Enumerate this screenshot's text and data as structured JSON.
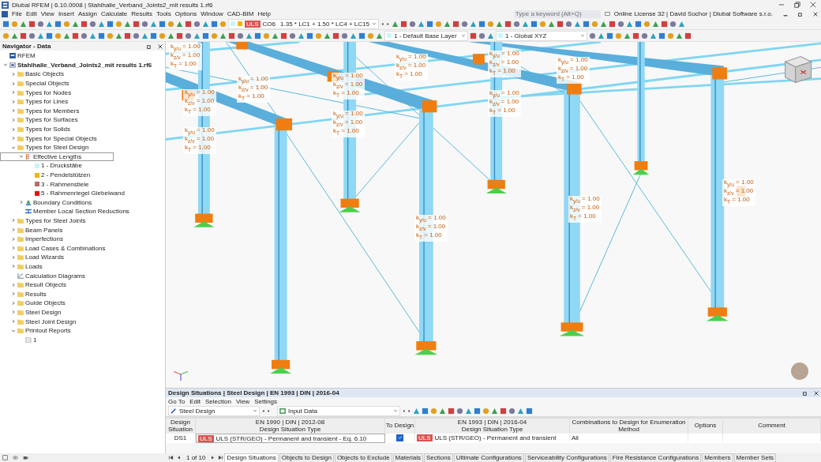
{
  "window": {
    "title": "Dlubal RFEM | 6.10.0008 | Stahlhalle_Verband_Joints2_mit results 1.rf6"
  },
  "menu": [
    "File",
    "Edit",
    "View",
    "Insert",
    "Assign",
    "Calculate",
    "Results",
    "Tools",
    "Options",
    "Window",
    "CAD-BIM",
    "Help"
  ],
  "search": {
    "placeholder": "Type a keyword (Alt+Q)"
  },
  "license": "Online License 32 | David Sochor | Dlubal Software s.r.o.",
  "toolbar": {
    "load_combo": {
      "badge": "ULS",
      "id": "CO6",
      "formula": "1.35 * LC1 + 1.50 * LC4 + LC15"
    },
    "layer": "1 - Default Base Layer",
    "coordinate_system": "1 - Global XYZ"
  },
  "navigator": {
    "title": "Navigator - Data",
    "tree": [
      {
        "label": "RFEM",
        "kind": "root",
        "selected": false
      },
      {
        "label": "Stahlhalle_Verband_Joints2_mit results 1.rf6",
        "kind": "file",
        "expanded": true,
        "selected": false,
        "children": [
          {
            "label": "Basic Objects",
            "kind": "folder",
            "expanded": false,
            "selected": false
          },
          {
            "label": "Special Objects",
            "kind": "folder",
            "expanded": false,
            "selected": false
          },
          {
            "label": "Types for Nodes",
            "kind": "folder",
            "expanded": false,
            "selected": false
          },
          {
            "label": "Types for Lines",
            "kind": "folder",
            "expanded": false,
            "selected": false
          },
          {
            "label": "Types for Members",
            "kind": "folder",
            "expanded": false,
            "selected": false
          },
          {
            "label": "Types for Surfaces",
            "kind": "folder",
            "expanded": false,
            "selected": false
          },
          {
            "label": "Types for Solids",
            "kind": "folder",
            "expanded": false,
            "selected": false
          },
          {
            "label": "Types for Special Objects",
            "kind": "folder",
            "expanded": false,
            "selected": false
          },
          {
            "label": "Types for Steel Design",
            "kind": "folder",
            "expanded": true,
            "selected": false,
            "children": [
              {
                "label": "Effective Lengths",
                "kind": "type",
                "expanded": true,
                "selected": true,
                "children": [
                  {
                    "label": "1 - Druckstäbe",
                    "kind": "color",
                    "color": "#c8f6fa",
                    "selected": false
                  },
                  {
                    "label": "2 - Pendelstützen",
                    "kind": "color",
                    "color": "#f5b400",
                    "selected": false
                  },
                  {
                    "label": "3 - Rahmenstiele",
                    "kind": "color",
                    "color": "#b46e6e",
                    "selected": false
                  },
                  {
                    "label": "5 - Rahmenriegel Giebelwand",
                    "kind": "color",
                    "color": "#e81010",
                    "selected": false
                  }
                ]
              },
              {
                "label": "Boundary Conditions",
                "kind": "boundary",
                "expanded": false,
                "selected": false
              },
              {
                "label": "Member Local Section Reductions",
                "kind": "reduction",
                "selected": false
              }
            ]
          },
          {
            "label": "Types for Steel Joints",
            "kind": "folder",
            "expanded": false,
            "selected": false
          },
          {
            "label": "Beam Panels",
            "kind": "folder",
            "expanded": false,
            "selected": false
          },
          {
            "label": "Imperfections",
            "kind": "folder",
            "expanded": false,
            "selected": false
          },
          {
            "label": "Load Cases & Combinations",
            "kind": "folder",
            "expanded": false,
            "selected": false
          },
          {
            "label": "Load Wizards",
            "kind": "folder",
            "expanded": false,
            "selected": false
          },
          {
            "label": "Loads",
            "kind": "folder",
            "expanded": false,
            "selected": false
          },
          {
            "label": "Calculation Diagrams",
            "kind": "diagram",
            "selected": false
          },
          {
            "label": "Result Objects",
            "kind": "folder",
            "expanded": false,
            "selected": false
          },
          {
            "label": "Results",
            "kind": "folder",
            "expanded": false,
            "selected": false
          },
          {
            "label": "Guide Objects",
            "kind": "folder",
            "expanded": false,
            "selected": false
          },
          {
            "label": "Steel Design",
            "kind": "folder",
            "expanded": false,
            "selected": false
          },
          {
            "label": "Steel Joint Design",
            "kind": "folder",
            "expanded": false,
            "selected": false
          },
          {
            "label": "Printout Reports",
            "kind": "folder",
            "expanded": true,
            "selected": false,
            "children": [
              {
                "label": "1",
                "kind": "page",
                "selected": false
              }
            ]
          }
        ]
      }
    ]
  },
  "viewport": {
    "member_labels": [
      {
        "lines": [
          "k$_{y/u}$ = 1.00",
          "k$_{z/v}$ = 1.00",
          "k$_{T}$ = 1.00"
        ]
      },
      {
        "lines": [
          "k$_{y/u}$ = 1.00",
          "k$_{z/v}$ = 1.00",
          "k$_{T}$ = 1.00"
        ]
      },
      {
        "lines": [
          "k$_{y/u}$ = 1.00",
          "k$_{z/v}$ = 1.00",
          "k$_{T}$ = 1.00"
        ]
      },
      {
        "lines": [
          "k$_{y/u}$ = 1.00",
          "k$_{z/v}$ = 1.00",
          "k$_{T}$ = 1.00"
        ]
      },
      {
        "lines": [
          "k$_{y/u}$ = 1.00",
          "k$_{z/v}$ = 1.00",
          "k$_{T}$ = 1.00"
        ]
      },
      {
        "lines": [
          "k$_{y/u}$ = 1.00",
          "k$_{z/v}$ = 1.00",
          "k$_{T}$ = 1.00"
        ]
      },
      {
        "lines": [
          "k$_{y/u}$ = 1.00",
          "k$_{z/v}$ = 1.00",
          "k$_{T}$ = 1.00"
        ]
      },
      {
        "lines": [
          "k$_{y/u}$ = 1.00",
          "k$_{z/v}$ = 1.00",
          "k$_{T}$ = 1.00"
        ]
      },
      {
        "lines": [
          "k$_{y/u}$ = 1.00",
          "k$_{z/v}$ = 1.00",
          "k$_{T}$ = 1.00"
        ]
      },
      {
        "lines": [
          "k$_{y/u}$ = 1.00",
          "k$_{z/v}$ = 1.00",
          "k$_{T}$ = 1.00"
        ]
      },
      {
        "lines": [
          "k$_{y/u}$ = 1.00",
          "k$_{z/v}$ = 1.00",
          "k$_{T}$ = 1.00"
        ]
      },
      {
        "lines": [
          "k$_{y/u}$ = 1.00",
          "k$_{z/v}$ = 1.00",
          "k$_{T}$ = 1.00"
        ]
      },
      {
        "lines": [
          "k$_{y/u}$ = 1.00",
          "k$_{z/v}$ = 1.00",
          "k$_{T}$ = 1.00"
        ]
      }
    ]
  },
  "panel": {
    "title": "Design Situations | Steel Design | EN 1993 | DIN | 2016-04",
    "menu": [
      "Go To",
      "Edit",
      "Selection",
      "View",
      "Settings"
    ],
    "module": "Steel Design",
    "table_view": "Input Data",
    "columns": [
      {
        "title": "Design Situation"
      },
      {
        "group": "EN 1990 | DIN | 2012-08",
        "title": "Design Situation Type"
      },
      {
        "title": "To Design"
      },
      {
        "group": "EN 1993 | DIN | 2016-04",
        "title": "Design Situation Type"
      },
      {
        "title": "Combinations to Design for Enumeration Method"
      },
      {
        "title": "Options"
      },
      {
        "title": "Comment"
      }
    ],
    "rows": [
      {
        "id": "DS1",
        "type_1990": {
          "badge": "ULS",
          "text": "ULS (STR/GEO) - Permanent and transient - Eq. 6.10"
        },
        "to_design": true,
        "type_1993": {
          "badge": "ULS",
          "text": "ULS (STR/GEO) - Permanent and transient"
        },
        "combinations": "All"
      }
    ],
    "page": "1 of 10",
    "tabs": [
      {
        "label": "Design Situations",
        "selected": true
      },
      {
        "label": "Objects to Design",
        "selected": false
      },
      {
        "label": "Objects to Exclude",
        "selected": false
      },
      {
        "label": "Materials",
        "selected": false
      },
      {
        "label": "Sections",
        "selected": false
      },
      {
        "label": "Ultimate Configurations",
        "selected": false
      },
      {
        "label": "Serviceability Configurations",
        "selected": false
      },
      {
        "label": "Fire Resistance Configurations",
        "selected": false
      },
      {
        "label": "Members",
        "selected": false
      },
      {
        "label": "Member Sets",
        "selected": false
      }
    ]
  }
}
